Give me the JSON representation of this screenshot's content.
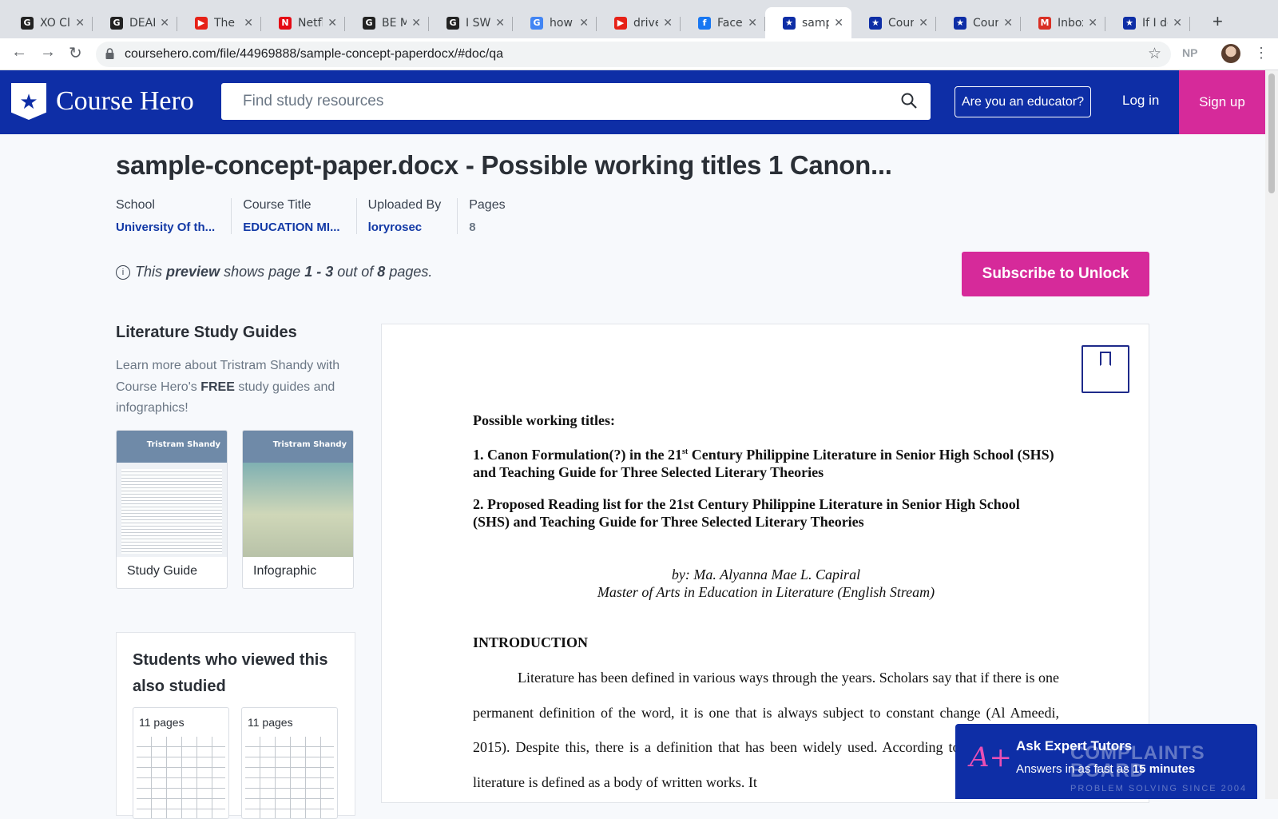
{
  "browser": {
    "tabs": [
      {
        "title": "XO Cl",
        "icon": "genius-icon",
        "color": "#222222",
        "glyph": "G"
      },
      {
        "title": "DEAR",
        "icon": "genius-icon",
        "color": "#222222",
        "glyph": "G"
      },
      {
        "title": "The R",
        "icon": "youtube-icon",
        "color": "#e62117",
        "glyph": "▶"
      },
      {
        "title": "Netfli",
        "icon": "netflix-icon",
        "color": "#e50914",
        "glyph": "N"
      },
      {
        "title": "BE M",
        "icon": "genius-icon",
        "color": "#222222",
        "glyph": "G"
      },
      {
        "title": "I SWE",
        "icon": "genius-icon",
        "color": "#222222",
        "glyph": "G"
      },
      {
        "title": "how t",
        "icon": "google-icon",
        "color": "#4285f4",
        "glyph": "G"
      },
      {
        "title": "drive",
        "icon": "youtube-icon",
        "color": "#e62117",
        "glyph": "▶"
      },
      {
        "title": "Faceb",
        "icon": "facebook-icon",
        "color": "#1877f2",
        "glyph": "f"
      },
      {
        "title": "samp",
        "icon": "coursehero-icon",
        "color": "#0e2ea6",
        "glyph": "★",
        "active": true
      },
      {
        "title": "Cours",
        "icon": "coursehero-icon",
        "color": "#0e2ea6",
        "glyph": "★"
      },
      {
        "title": "Cours",
        "icon": "coursehero-icon",
        "color": "#0e2ea6",
        "glyph": "★"
      },
      {
        "title": "Inbox",
        "icon": "gmail-icon",
        "color": "#d93025",
        "glyph": "M"
      },
      {
        "title": "If I de",
        "icon": "coursehero-icon",
        "color": "#0e2ea6",
        "glyph": "★"
      }
    ],
    "new_tab": "+",
    "url": "coursehero.com/file/44969888/sample-concept-paperdocx/#doc/qa",
    "extension_label": "NP"
  },
  "header": {
    "logo_text": "Course Hero",
    "search_placeholder": "Find study resources",
    "educator_label": "Are you an educator?",
    "login_label": "Log in",
    "signup_label": "Sign up"
  },
  "doc": {
    "title": "sample-concept-paper.docx - Possible working titles 1 Canon...",
    "meta": [
      {
        "key": "School",
        "value": "University Of th..."
      },
      {
        "key": "Course Title",
        "value": "EDUCATION MI..."
      },
      {
        "key": "Uploaded By",
        "value": "loryrosec"
      },
      {
        "key": "Pages",
        "value": "8"
      }
    ],
    "preview": {
      "pre": "This ",
      "word": "preview",
      "mid": " shows page ",
      "range": "1 - 3",
      "out": " out of ",
      "total": "8",
      "post": " pages."
    },
    "subscribe_label": "Subscribe to Unlock"
  },
  "sidebar": {
    "guides_title": "Literature Study Guides",
    "guides_desc_pre": "Learn more about Tristram Shandy with Course Hero's ",
    "guides_desc_bold": "FREE",
    "guides_desc_post": " study guides and infographics!",
    "cards": [
      {
        "label": "Study Guide",
        "thumb_title": "Tristram Shandy"
      },
      {
        "label": "Infographic",
        "thumb_title": "Tristram Shandy"
      }
    ],
    "also_title": "Students who viewed this also studied",
    "also_items": [
      {
        "pages": "11 pages"
      },
      {
        "pages": "11 pages"
      }
    ]
  },
  "paper": {
    "heading": "Possible working titles:",
    "item1_pre": "1. Canon Formulation(?) in the 21",
    "item1_sup": "st",
    "item1_post": " Century Philippine Literature in Senior High School (SHS) and Teaching Guide for Three Selected Literary Theories",
    "item2": "2. Proposed Reading list for the 21st Century Philippine Literature in Senior High School (SHS) and Teaching Guide for Three Selected Literary Theories",
    "byline1": "by: Ma. Alyanna Mae L. Capiral",
    "byline2": "Master of Arts in Education in Literature (English Stream)",
    "section": "INTRODUCTION",
    "body": "Literature has been defined in various ways through the years. Scholars say that if there is one permanent definition of the word, it is one that is always subject to constant change (Al Ameedi, 2015). Despite this, there is a definition that has been widely used. According to Rexroth (2018), literature is defined as a body of written works. It"
  },
  "tutor": {
    "title": "Ask Expert Tutors",
    "sub_pre": "Answers in as fast as ",
    "sub_bold": "15 minutes"
  },
  "watermark": {
    "line1": "COMPLAINTS",
    "line2": "BOARD",
    "small": "PROBLEM SOLVING SINCE 2004"
  }
}
